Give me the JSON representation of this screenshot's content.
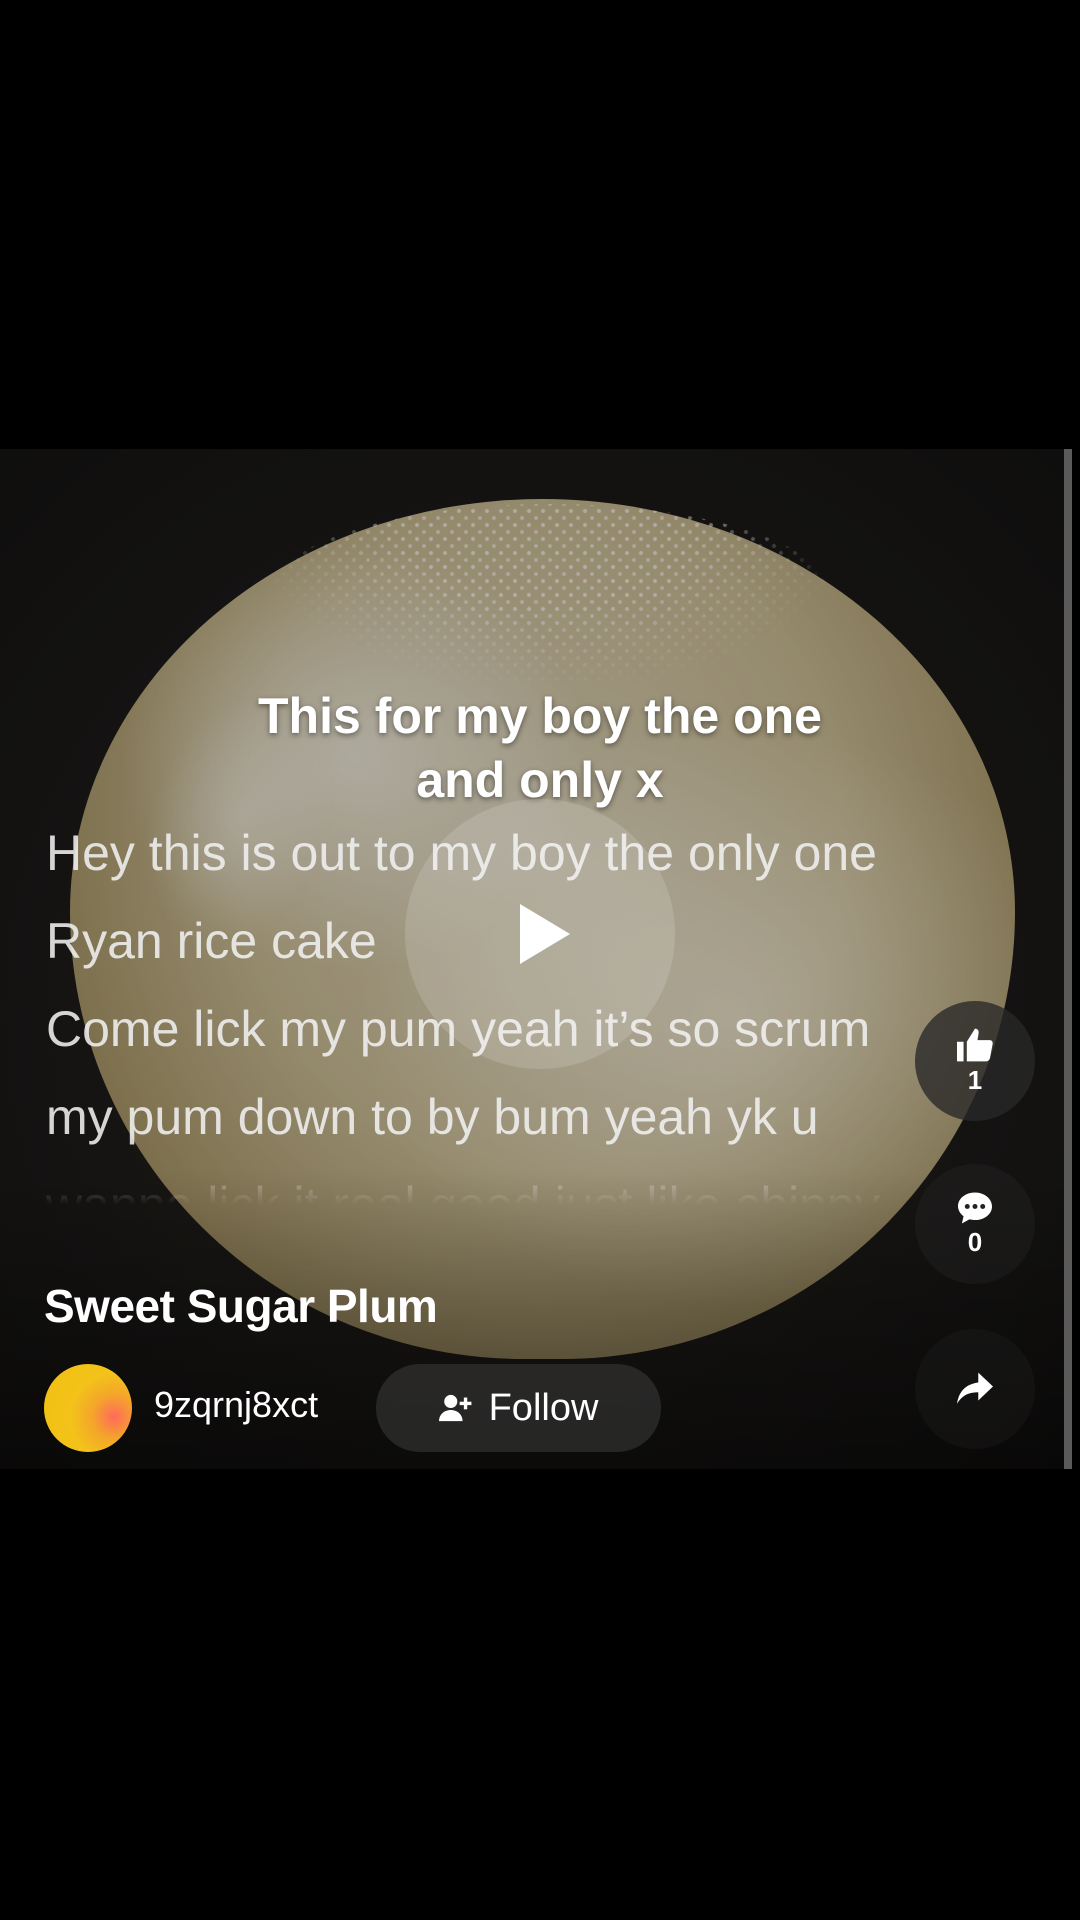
{
  "post": {
    "caption": "This for my boy the one\nand only x",
    "lyrics": [
      "Hey this is out to my boy the only one",
      "Ryan rice cake",
      "Come lick my pum yeah it’s so scrum",
      "my pum down to by bum yeah yk u",
      "wanna lick it real good just like chippy"
    ],
    "song_title": "Sweet Sugar Plum",
    "username": "9zqrnj8xct",
    "follow_label": "Follow"
  },
  "actions": {
    "like_count": "1",
    "comment_count": "0"
  },
  "icons": {
    "play": "play-icon",
    "like": "thumbs-up-icon",
    "comment": "comment-bubble-icon",
    "share": "share-arrow-icon",
    "follow": "add-user-icon"
  },
  "colors": {
    "background": "#000000",
    "text": "#ffffff",
    "avatar": "#f3c31a"
  }
}
